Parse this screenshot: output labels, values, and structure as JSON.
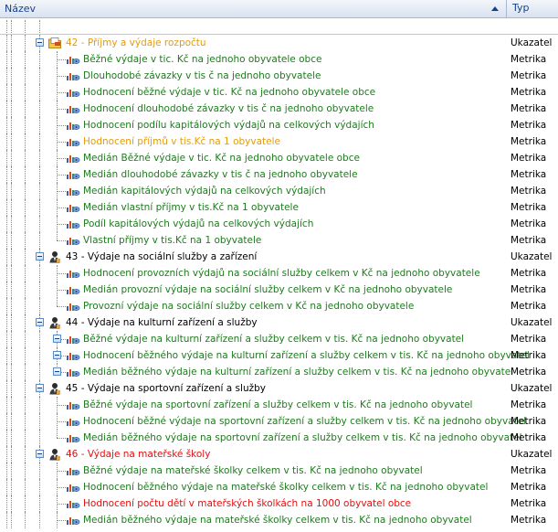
{
  "header": {
    "name_label": "Název",
    "type_label": "Typ"
  },
  "colors": {
    "orange": "#e49b0f",
    "green": "#1f7a1f",
    "red": "#e01010",
    "black": "#000000"
  },
  "rows": [
    {
      "level": 0,
      "icon": "folder-icon",
      "label": "42 - Příjmy a výdaje rozpočtu",
      "type": "Ukazatel",
      "color": "orange"
    },
    {
      "level": 1,
      "icon": "metric-icon",
      "label": "Běžné výdaje v tic. Kč na jednoho obyvatele obce",
      "type": "Metrika",
      "color": "green"
    },
    {
      "level": 1,
      "icon": "metric-icon",
      "label": "Dlouhodobé závazky v tis č na jednoho obyvatele",
      "type": "Metrika",
      "color": "green"
    },
    {
      "level": 1,
      "icon": "metric-icon",
      "label": "Hodnocení běžné výdaje v tic. Kč na jednoho obyvatele obce",
      "type": "Metrika",
      "color": "green"
    },
    {
      "level": 1,
      "icon": "metric-icon",
      "label": "Hodnocení dlouhodobé závazky v tis č na jednoho obyvatele",
      "type": "Metrika",
      "color": "green"
    },
    {
      "level": 1,
      "icon": "metric-icon",
      "label": "Hodnocení podílu kapitálových výdajů na celkových výdajích",
      "type": "Metrika",
      "color": "green"
    },
    {
      "level": 1,
      "icon": "metric-icon",
      "label": "Hodnocení příjmů v tis.Kč na 1 obyvatele",
      "type": "Metrika",
      "color": "orange"
    },
    {
      "level": 1,
      "icon": "metric-icon",
      "label": "Medián Běžné výdaje v tic. Kč na jednoho obyvatele obce",
      "type": "Metrika",
      "color": "green"
    },
    {
      "level": 1,
      "icon": "metric-icon",
      "label": "Medián dlouhodobé závazky v tis č na jednoho obyvatele",
      "type": "Metrika",
      "color": "green"
    },
    {
      "level": 1,
      "icon": "metric-icon",
      "label": "Medián kapitálových výdajů na celkových výdajích",
      "type": "Metrika",
      "color": "green"
    },
    {
      "level": 1,
      "icon": "metric-icon",
      "label": "Medián vlastní příjmy v tis.Kč na 1 obyvatele",
      "type": "Metrika",
      "color": "green"
    },
    {
      "level": 1,
      "icon": "metric-icon",
      "label": "Podíl kapitálových výdajů na celkových výdajích",
      "type": "Metrika",
      "color": "green"
    },
    {
      "level": 1,
      "icon": "metric-icon",
      "label": "Vlastní příjmy v tis.Kč na 1 obyvatele",
      "type": "Metrika",
      "color": "green",
      "last": true
    },
    {
      "level": 0,
      "icon": "user-icon",
      "label": "43 - Výdaje na sociální služby a zařízení",
      "type": "Ukazatel",
      "color": "black"
    },
    {
      "level": 1,
      "icon": "metric-icon",
      "label": "Hodnocení provozních výdajů na sociální služby celkem v Kč na jednoho obyvatele",
      "type": "Metrika",
      "color": "green"
    },
    {
      "level": 1,
      "icon": "metric-icon",
      "label": "Medián provozní výdaje na sociální služby celkem v Kč na jednoho obyvatele",
      "type": "Metrika",
      "color": "green"
    },
    {
      "level": 1,
      "icon": "metric-icon",
      "label": "Provozní výdaje na sociální služby celkem v Kč na jednoho obyvatele",
      "type": "Metrika",
      "color": "green",
      "last": true
    },
    {
      "level": 0,
      "icon": "user-icon",
      "label": "44 - Výdaje na kulturní zařízení a služby",
      "type": "Ukazatel",
      "color": "black"
    },
    {
      "level": 1,
      "icon": "metric-icon",
      "label": "Běžné výdaje na kulturní zařízení a služby celkem v tis. Kč na jednoho obyvatel",
      "type": "Metrika",
      "color": "green",
      "toggle": true
    },
    {
      "level": 1,
      "icon": "metric-icon",
      "label": "Hodnocení běžného výdaje na kulturní zařízení a služby celkem v tis. Kč na jednoho obyvatel",
      "type": "Metrika",
      "color": "green",
      "toggle": true
    },
    {
      "level": 1,
      "icon": "metric-icon",
      "label": "Medián běžného výdaje na kulturní zařízení a služby celkem v tis. Kč na jednoho obyvatel",
      "type": "Metrika",
      "color": "green",
      "toggle": true,
      "last": true
    },
    {
      "level": 0,
      "icon": "user-icon",
      "label": "45 - Výdaje na sportovní zařízení a služby",
      "type": "Ukazatel",
      "color": "black"
    },
    {
      "level": 1,
      "icon": "metric-icon",
      "label": "Běžné výdaje na sportovní  zařízení a služby celkem v tis. Kč na jednoho obyvatel",
      "type": "Metrika",
      "color": "green"
    },
    {
      "level": 1,
      "icon": "metric-icon",
      "label": "Hodnocení běžné výdaje na sportovní  zařízení a služby celkem v tis. Kč na jednoho obyvatel",
      "type": "Metrika",
      "color": "green"
    },
    {
      "level": 1,
      "icon": "metric-icon",
      "label": "Medián běžného  výdaje na sportovní  zařízení a služby celkem v tis. Kč na jednoho obyvatel",
      "type": "Metrika",
      "color": "green",
      "last": true
    },
    {
      "level": 0,
      "icon": "user-icon",
      "label": "46 - Výdaje na mateřské školy",
      "type": "Ukazatel",
      "color": "red"
    },
    {
      "level": 1,
      "icon": "metric-icon",
      "label": "Běžné výdaje na mateřské školky celkem v tis. Kč na jednoho obyvatel",
      "type": "Metrika",
      "color": "green"
    },
    {
      "level": 1,
      "icon": "metric-icon",
      "label": "Hodnocení běžného výdaje na mateřské školky celkem v tis. Kč na jednoho obyvatel",
      "type": "Metrika",
      "color": "green"
    },
    {
      "level": 1,
      "icon": "metric-icon",
      "label": "Hodnocení počtu dětí v mateřských školkách na 1000 obyvatel obce",
      "type": "Metrika",
      "color": "red"
    },
    {
      "level": 1,
      "icon": "metric-icon",
      "label": "Medián běžného výdaje na mateřské školky celkem v tis. Kč na jednoho obyvatel",
      "type": "Metrika",
      "color": "green"
    }
  ]
}
